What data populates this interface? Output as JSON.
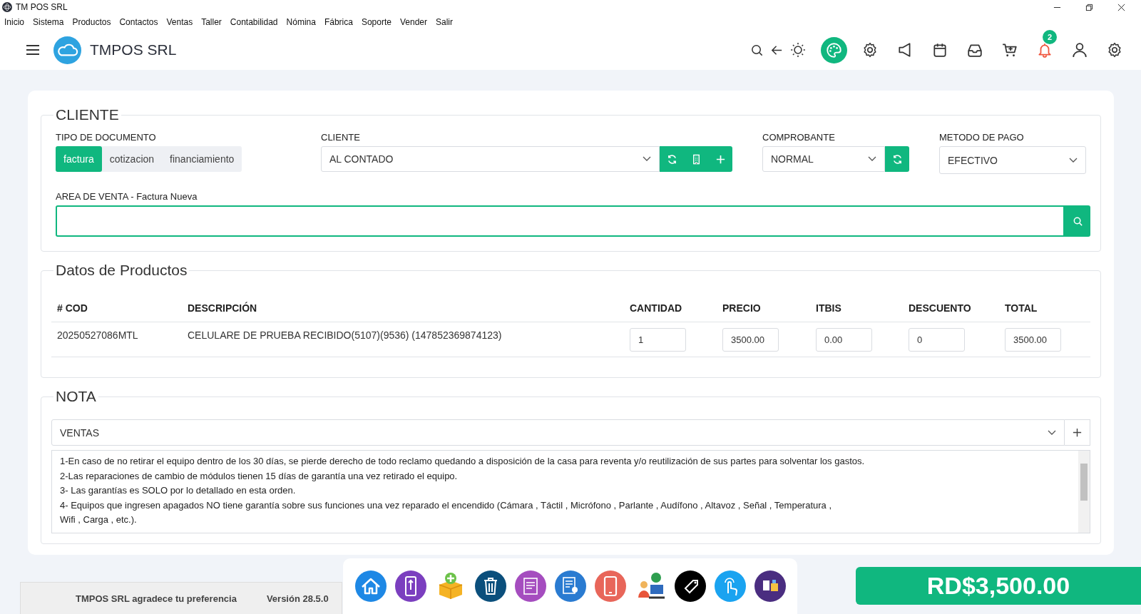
{
  "window": {
    "title": "TM POS SRL"
  },
  "menu": [
    "Inicio",
    "Sistema",
    "Productos",
    "Contactos",
    "Ventas",
    "Taller",
    "Contabilidad",
    "Nómina",
    "Fábrica",
    "Soporte",
    "Vender",
    "Salir"
  ],
  "header": {
    "brand": "TMPOS SRL",
    "notification_count": "2"
  },
  "cliente": {
    "legend": "CLIENTE",
    "tipo_documento": {
      "label": "TIPO DE DOCUMENTO",
      "options": [
        {
          "label": "factura",
          "selected": true
        },
        {
          "label": "cotizacion",
          "selected": false
        },
        {
          "label": "financiamiento",
          "selected": false
        }
      ]
    },
    "cliente": {
      "label": "CLIENTE",
      "value": "AL CONTADO"
    },
    "comprobante": {
      "label": "COMPROBANTE",
      "value": "NORMAL"
    },
    "metodo_pago": {
      "label": "METODO DE PAGO",
      "value": "EFECTIVO"
    },
    "area_venta": {
      "label": "AREA DE VENTA - Factura Nueva"
    }
  },
  "productos": {
    "legend": "Datos de Productos",
    "columns": [
      "# COD",
      "DESCRIPCIÓN",
      "CANTIDAD",
      "PRECIO",
      "ITBIS",
      "DESCUENTO",
      "TOTAL"
    ],
    "rows": [
      {
        "cod": "20250527086MTL",
        "descripcion": "CELULARE DE PRUEBA RECIBIDO(5107)(9536) (147852369874123)",
        "cantidad": "1",
        "precio": "3500.00",
        "itbis": "0.00",
        "descuento": "0",
        "total": "3500.00"
      }
    ]
  },
  "nota": {
    "legend": "NOTA",
    "category": "VENTAS",
    "lines": [
      "1-En caso de no retirar el equipo dentro de los 30 días, se pierde derecho de todo reclamo quedando a disposición de la casa para reventa y/o reutilización de sus partes para solventar los gastos.",
      "2-Las reparaciones de cambio de módulos tienen 15 días de garantía una vez retirado el equipo.",
      "3- Las garantías es SOLO por lo detallado en esta orden.",
      "4- Equipos que ingresen apagados NO tiene garantía sobre sus funciones una vez reparado el encendido (Cámara , Táctil , Micrófono , Parlante , Audífono , Altavoz , Señal , Temperatura ,",
      "Wifi , Carga , etc.)."
    ]
  },
  "footer": {
    "thanks": "TMPOS SRL agradece tu preferencia",
    "version": "Versión 28.5.0"
  },
  "total": "RD$3,500.00"
}
